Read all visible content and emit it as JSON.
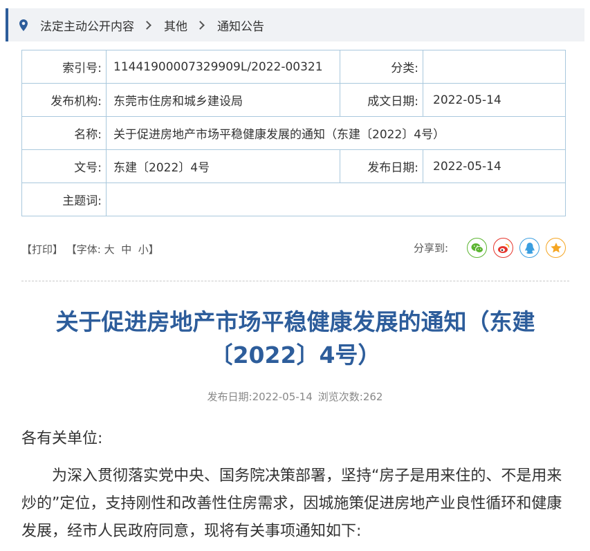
{
  "breadcrumb": {
    "items": [
      "法定主动公开内容",
      "其他",
      "通知公告"
    ]
  },
  "meta": {
    "index_label": "索引号:",
    "index_value": "11441900007329909L/2022-00321",
    "category_label": "分类:",
    "category_value": "",
    "issuer_label": "发布机构:",
    "issuer_value": "东莞市住房和城乡建设局",
    "written_label": "成文日期:",
    "written_value": "2022-05-14",
    "name_label": "名称:",
    "name_value": "关于促进房地产市场平稳健康发展的通知（东建〔2022〕4号）",
    "docno_label": "文号:",
    "docno_value": "东建〔2022〕4号",
    "publish_label": "发布日期:",
    "publish_value": "2022-05-14",
    "keywords_label": "主题词:",
    "keywords_value": ""
  },
  "tools": {
    "print": "【打印】",
    "font_open": "【字体:",
    "font_large": "大",
    "font_medium": "中",
    "font_small": "小",
    "font_close": "】"
  },
  "share": {
    "label": "分享到:",
    "icons": [
      "wechat-icon",
      "weibo-icon",
      "qq-icon",
      "qzone-icon"
    ],
    "colors": {
      "wechat": "#5cb531",
      "weibo": "#e6362d",
      "qq": "#3a9ee0",
      "qzone": "#f5a623"
    }
  },
  "article": {
    "title_line1": "关于促进房地产市场平稳健康发展的通知（东建",
    "title_line2": "〔2022〕4号）",
    "publish_date": "发布日期:2022-05-14",
    "views": "浏览次数:262",
    "salutation": "各有关单位:",
    "paragraph1": "为深入贯彻落实党中央、国务院决策部署，坚持“房子是用来住的、不是用来炒的”定位，支持刚性和改善性住房需求，因城施策促进房地产业良性循环和健康发展，经市人民政府同意，现将有关事项通知如下:"
  },
  "colors": {
    "accent": "#2d5d9b",
    "table_border": "#a9c8dd",
    "breadcrumb_bg": "#f0f2f5"
  }
}
